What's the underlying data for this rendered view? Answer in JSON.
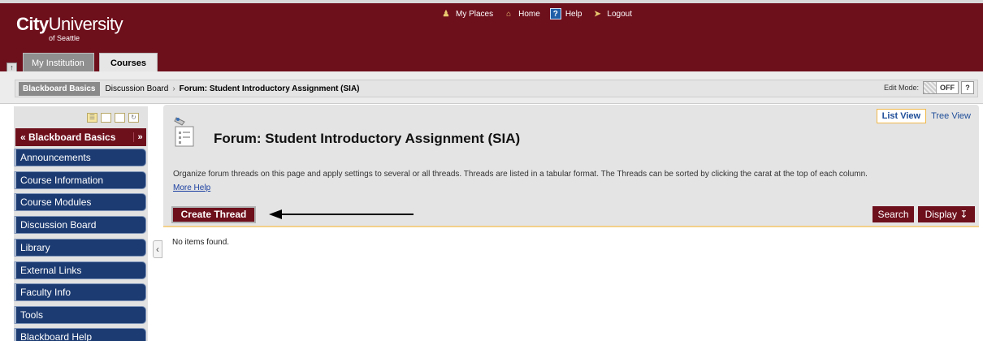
{
  "logo": {
    "city": "City",
    "university": "University",
    "sub": "of Seattle"
  },
  "topnav": [
    {
      "label": "My Places",
      "icon": "person-icon"
    },
    {
      "label": "Home",
      "icon": "home-icon"
    },
    {
      "label": "Help",
      "icon": "help-icon"
    },
    {
      "label": "Logout",
      "icon": "logout-icon"
    }
  ],
  "tabs": [
    {
      "label": "My Institution"
    },
    {
      "label": "Courses"
    }
  ],
  "breadcrumb": {
    "course": "Blackboard Basics",
    "section": "Discussion Board",
    "current": "Forum: Student Introductory Assignment (SIA)"
  },
  "edit_mode": {
    "label": "Edit Mode:",
    "state": "OFF",
    "help": "?"
  },
  "course_menu": {
    "title": "Blackboard Basics",
    "items": [
      "Announcements",
      "Course Information",
      "Course Modules",
      "Discussion Board",
      "Library",
      "External Links",
      "Faculty Info",
      "Tools",
      "Blackboard Help"
    ]
  },
  "views": {
    "list": "List View",
    "tree": "Tree View"
  },
  "page": {
    "title": "Forum: Student Introductory Assignment (SIA)",
    "description": "Organize forum threads on this page and apply settings to several or all threads. Threads are listed in a tabular format. The Threads can be sorted by clicking the carat at the top of each column.",
    "more_help": "More Help",
    "empty": "No items found."
  },
  "actions": {
    "create_thread": "Create Thread",
    "search": "Search",
    "display": "Display"
  },
  "colors": {
    "maroon": "#6e0f1c",
    "menu_blue": "#1c3b72",
    "link": "#1a3fa0"
  }
}
